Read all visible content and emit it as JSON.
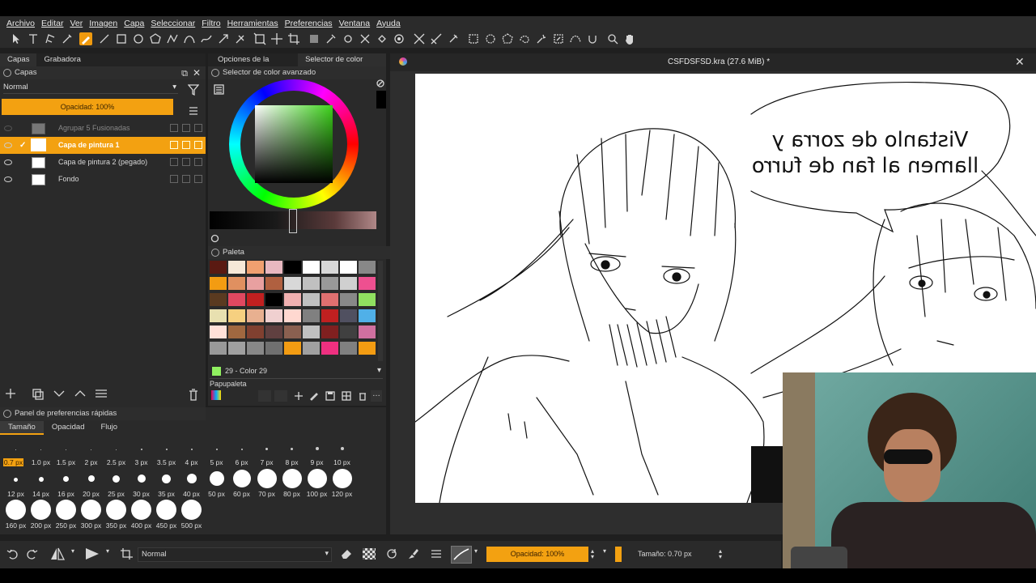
{
  "menu": [
    "Archivo",
    "Editar",
    "Ver",
    "Imagen",
    "Capa",
    "Seleccionar",
    "Filtro",
    "Herramientas",
    "Preferencias",
    "Ventana",
    "Ayuda"
  ],
  "left_tabs": {
    "layers": "Capas",
    "recorder": "Grabadora"
  },
  "layers_panel": {
    "title": "Capas",
    "blend_mode": "Normal",
    "opacity": "Opacidad: 100%",
    "layers": [
      {
        "name": "Agrupar 5 Fusionadas",
        "state": "dim"
      },
      {
        "name": "Capa de pintura 1",
        "state": "selected"
      },
      {
        "name": "Capa de pintura 2 (pegado)",
        "state": "normal"
      },
      {
        "name": "Fondo",
        "state": "normal"
      }
    ]
  },
  "mid_tabs": {
    "tool_options": "Opciones de la herr...",
    "color_selector": "Selector de color av..."
  },
  "color_selector": {
    "title": "Selector de color avanzado",
    "color": "#4f9e2e"
  },
  "palette": {
    "title": "Paleta",
    "selected": "29 - Color 29",
    "papupaleta": "Papupaleta",
    "colors": [
      "#5a1a12",
      "#f6e8d8",
      "#f0a070",
      "#e8b8c0",
      "#000000",
      "#ffffff",
      "#d8d8d8",
      "#ffffff",
      "#888888",
      "#f39c12",
      "#e09060",
      "#e8a0a0",
      "#b06040",
      "#d8d8d8",
      "#c0c0c0",
      "#999999",
      "#d0d0d0",
      "#ee5090",
      "#5a3a20",
      "#e04860",
      "#c02020",
      "#000000",
      "#f0b0b0",
      "#c0c0c0",
      "#e07070",
      "#888888",
      "#90e060",
      "#e8e0b0",
      "#f6d080",
      "#e8b090",
      "#f0d0d0",
      "#ffd8d0",
      "#808080",
      "#c02020",
      "#505060",
      "#50b0e8",
      "#ffe0d8",
      "#a06840",
      "#804030",
      "#604040",
      "#8a6050",
      "#c0c0c0",
      "#802020",
      "#404040",
      "#d070a0",
      "#999999",
      "#a0a0a0",
      "#888888",
      "#707070",
      "#f39c12",
      "#a0a0a0",
      "#ee3080",
      "#808080",
      "#f39c12"
    ]
  },
  "quick_prefs": {
    "title": "Panel de preferencias rápidas",
    "tabs": [
      "Tamaño",
      "Opacidad",
      "Flujo"
    ],
    "row1": [
      "0.7 px",
      "1.0 px",
      "1.5 px",
      "2 px",
      "2.5 px",
      "3 px",
      "3.5 px",
      "4 px",
      "5 px",
      "6 px",
      "7 px",
      "8 px",
      "9 px",
      "10 px"
    ],
    "row2": [
      "12 px",
      "14 px",
      "16 px",
      "20 px",
      "25 px",
      "30 px",
      "35 px",
      "40 px",
      "50 px",
      "60 px",
      "70 px",
      "80 px",
      "100 px",
      "120 px"
    ],
    "row3": [
      "160 px",
      "200 px",
      "250 px",
      "300 px",
      "350 px",
      "400 px",
      "450 px",
      "500 px"
    ]
  },
  "document": {
    "title": "CSFDSFSD.kra (27.6 MiB) *"
  },
  "speech_bubble": {
    "line1": "Vistanlo de zorra y",
    "line2": "llamen al fan de furro"
  },
  "bottom_bar": {
    "blend": "Normal",
    "opacity": "Opacidad: 100%",
    "size": "Tamaño: 0.70 px"
  },
  "accent": "#f3a111"
}
